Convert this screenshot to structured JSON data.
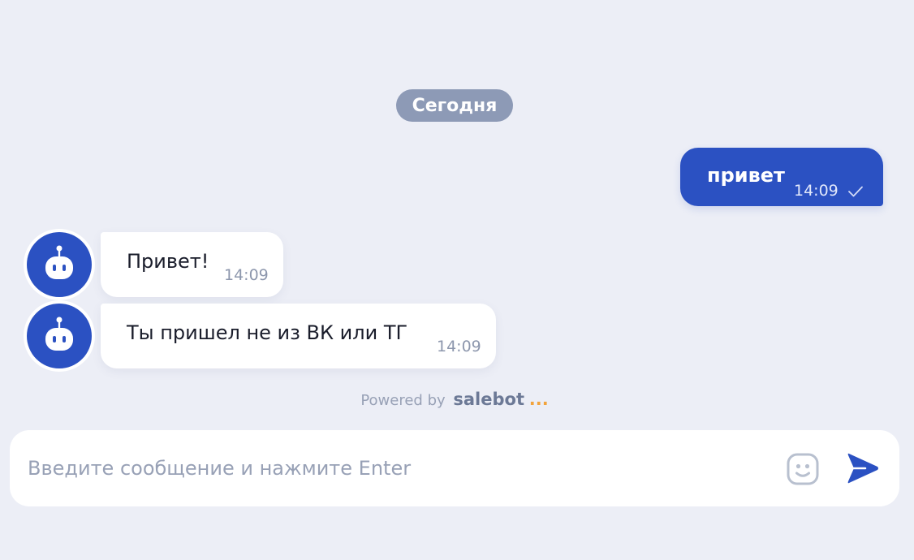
{
  "chat": {
    "date_separator": "Сегодня",
    "messages": [
      {
        "direction": "outgoing",
        "text": "привет",
        "time": "14:09",
        "status": "sent"
      },
      {
        "direction": "incoming",
        "text": "Привет!",
        "time": "14:09",
        "avatar_icon": "robot-icon"
      },
      {
        "direction": "incoming",
        "text": "Ты пришел не из ВК или ТГ",
        "time": "14:09",
        "avatar_icon": "robot-icon"
      }
    ]
  },
  "footer": {
    "powered_prefix": "Powered by",
    "brand": "salebot",
    "brand_dots": "..."
  },
  "composer": {
    "placeholder": "Введите сообщение и нажмите Enter",
    "value": "",
    "emoji_icon": "emoji-icon",
    "send_icon": "send-icon"
  },
  "colors": {
    "background": "#eceef6",
    "accent": "#2b51c2",
    "date_pill": "#8d9ab6",
    "brand_dots": "#f2a33c"
  }
}
